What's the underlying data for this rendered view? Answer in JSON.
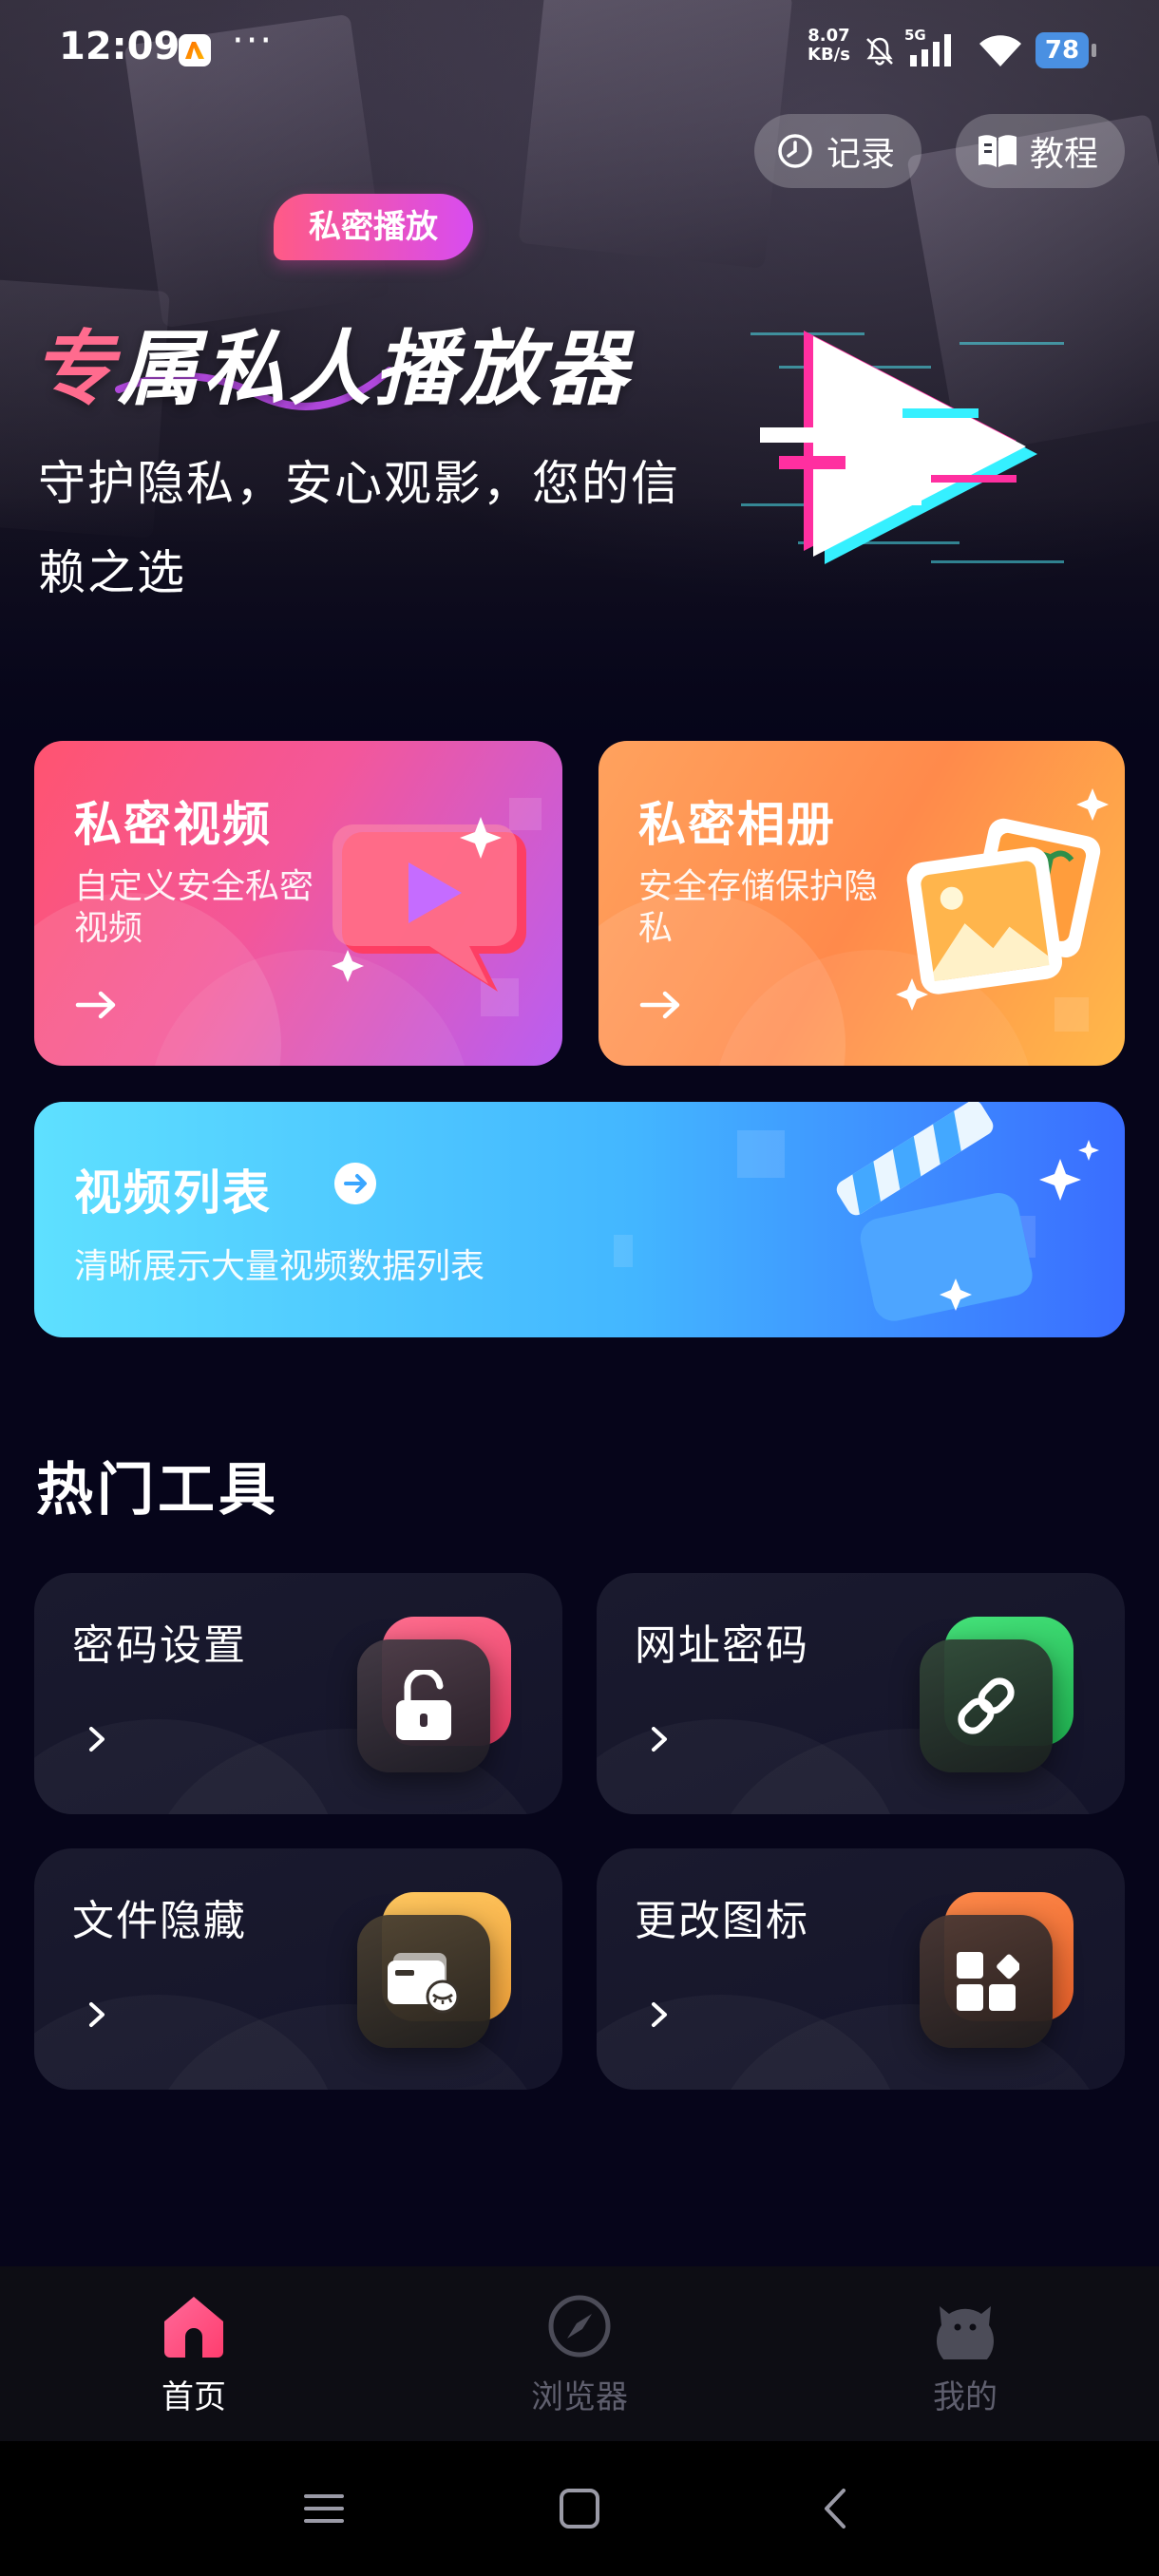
{
  "status_bar": {
    "time": "12:09",
    "more": "···",
    "speed_value": "8.07",
    "speed_unit": "KB/s",
    "network": "5G",
    "battery": "78"
  },
  "header": {
    "record_label": "记录",
    "tutorial_label": "教程"
  },
  "hero": {
    "tag": "私密播放",
    "title_first_char": "专",
    "title_rest": "属私人播放器",
    "subtitle": "守护隐私，安心观影，您的信赖之选"
  },
  "features": {
    "private_video": {
      "title": "私密视频",
      "desc": "自定义安全私密视频",
      "arrow": "→"
    },
    "private_album": {
      "title": "私密相册",
      "desc": "安全存储保护隐私",
      "arrow": "→"
    },
    "video_list": {
      "title": "视频列表",
      "desc": "清晰展示大量视频数据列表"
    }
  },
  "hot_tools": {
    "title": "热门工具",
    "items": [
      {
        "label": "密码设置",
        "icon": "lock-icon",
        "accent": "#ff4f7a"
      },
      {
        "label": "网址密码",
        "icon": "link-icon",
        "accent": "#3cd66a"
      },
      {
        "label": "文件隐藏",
        "icon": "hidden-file-icon",
        "accent": "#ffb347"
      },
      {
        "label": "更改图标",
        "icon": "apps-icon",
        "accent": "#ff7a3c"
      }
    ]
  },
  "bottom_nav": {
    "items": [
      {
        "label": "首页",
        "icon": "home-icon",
        "active": true
      },
      {
        "label": "浏览器",
        "icon": "compass-icon",
        "active": false
      },
      {
        "label": "我的",
        "icon": "profile-icon",
        "active": false
      }
    ]
  },
  "colors": {
    "background": "#06051a",
    "accent_pink": "#ff6b8e",
    "nav_active": "#ff5a86"
  }
}
